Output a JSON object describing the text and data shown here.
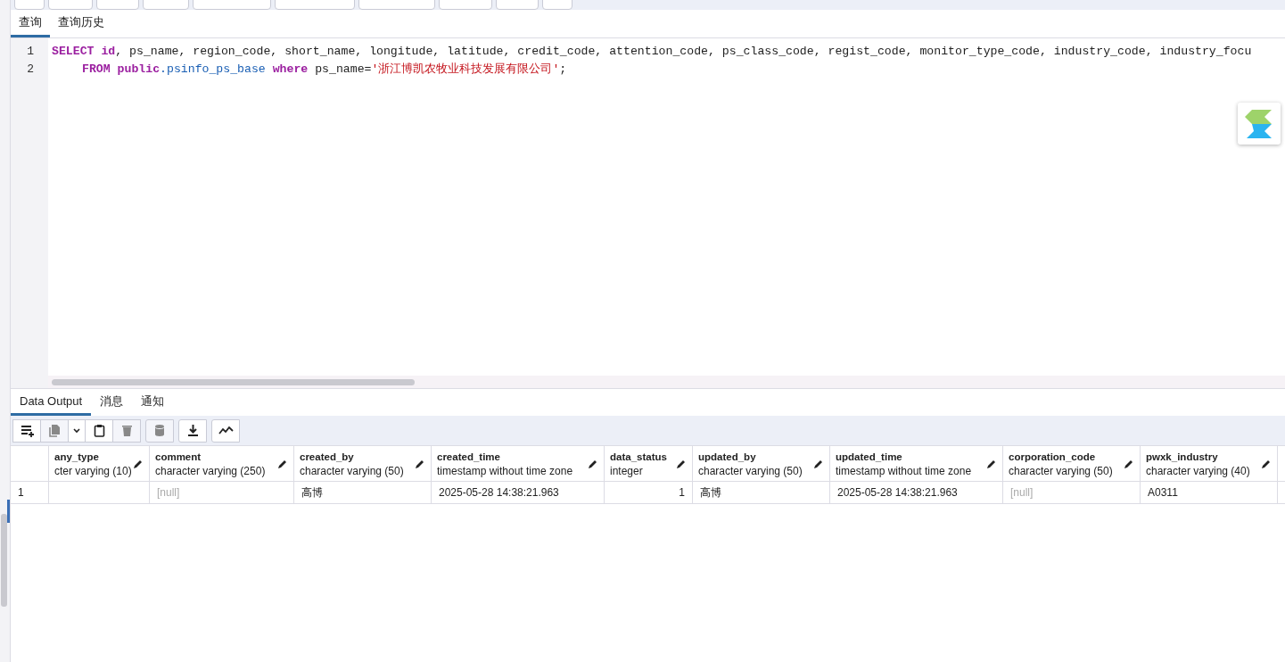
{
  "query_tabs": [
    {
      "label": "查询",
      "selected": true
    },
    {
      "label": "查询历史",
      "selected": false
    }
  ],
  "editor": {
    "lines": [
      {
        "number": "1",
        "indented": false,
        "tokens": [
          {
            "text": "SELECT ",
            "kind": "keyword"
          },
          {
            "text": "id",
            "kind": "keyword"
          },
          {
            "text": ", ps_name, region_code, short_name, longitude, latitude, credit_code, attention_code, ps_class_code, regist_code, monitor_type_code, industry_code, industry_focu",
            "kind": "plain"
          }
        ]
      },
      {
        "number": "2",
        "indented": true,
        "tokens": [
          {
            "text": "FROM ",
            "kind": "keyword"
          },
          {
            "text": "public",
            "kind": "keyword"
          },
          {
            "text": ".psinfo_ps_base ",
            "kind": "name"
          },
          {
            "text": "where",
            "kind": "keyword"
          },
          {
            "text": " ps_name=",
            "kind": "plain"
          },
          {
            "text": "'浙江博凯农牧业科技发展有限公司'",
            "kind": "string"
          },
          {
            "text": ";",
            "kind": "plain"
          }
        ]
      }
    ]
  },
  "output_tabs": [
    {
      "label": "Data Output",
      "selected": true
    },
    {
      "label": "消息",
      "selected": false
    },
    {
      "label": "通知",
      "selected": false
    }
  ],
  "output_toolbar": [
    {
      "kind": "add-row",
      "disabled": false
    },
    {
      "kind": "copy",
      "disabled": true
    },
    {
      "kind": "caret",
      "disabled": false
    },
    {
      "kind": "paste",
      "disabled": false
    },
    {
      "kind": "delete",
      "disabled": true
    },
    {
      "kind": "save",
      "disabled": true
    },
    {
      "kind": "download",
      "disabled": false
    },
    {
      "kind": "graph",
      "disabled": false
    }
  ],
  "table": {
    "columns": [
      {
        "name": "any_type",
        "type": "cter varying (10)"
      },
      {
        "name": "comment",
        "type": "character varying (250)"
      },
      {
        "name": "created_by",
        "type": "character varying (50)"
      },
      {
        "name": "created_time",
        "type": "timestamp without time zone"
      },
      {
        "name": "data_status",
        "type": "integer",
        "kind": "number"
      },
      {
        "name": "updated_by",
        "type": "character varying (50)"
      },
      {
        "name": "updated_time",
        "type": "timestamp without time zone"
      },
      {
        "name": "corporation_code",
        "type": "character varying (50)"
      },
      {
        "name": "pwxk_industry",
        "type": "character varying (40)"
      }
    ],
    "rows": [
      {
        "number": "1",
        "cells": [
          {},
          {
            "text": "[null]",
            "null": true
          },
          {
            "text": "高博",
            "null": false
          },
          {
            "text": "2025-05-28 14:38:21.963",
            "null": false
          },
          {
            "text": "1",
            "null": false
          },
          {
            "text": "高博",
            "null": false
          },
          {
            "text": "2025-05-28 14:38:21.963",
            "null": false
          },
          {
            "text": "[null]",
            "null": true
          },
          {
            "text": "A0311",
            "null": false
          }
        ]
      }
    ]
  }
}
